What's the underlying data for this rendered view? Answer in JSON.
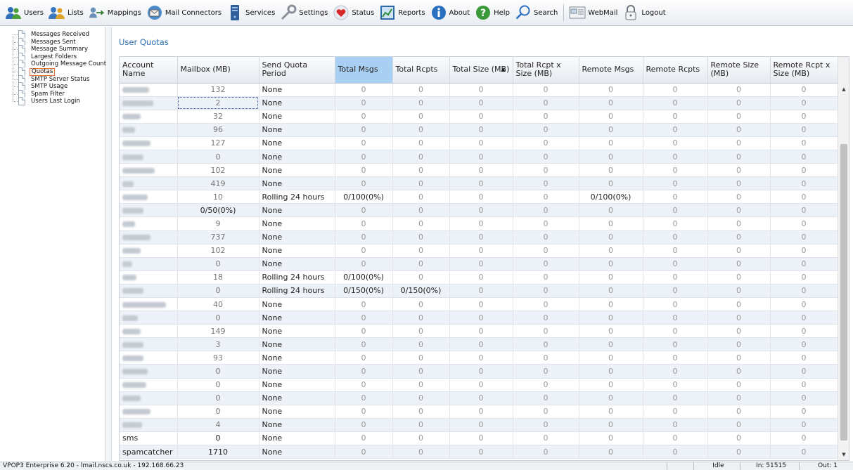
{
  "toolbar": {
    "items": [
      {
        "label": "Users",
        "icon": "users-icon"
      },
      {
        "label": "Lists",
        "icon": "lists-icon"
      },
      {
        "label": "Mappings",
        "icon": "mappings-icon"
      },
      {
        "label": "Mail Connectors",
        "icon": "mail-connectors-icon"
      },
      {
        "label": "Services",
        "icon": "services-icon"
      },
      {
        "label": "Settings",
        "icon": "settings-icon"
      },
      {
        "label": "Status",
        "icon": "status-heart-icon"
      },
      {
        "label": "Reports",
        "icon": "reports-icon"
      },
      {
        "label": "About",
        "icon": "about-info-icon"
      },
      {
        "label": "Help",
        "icon": "help-icon"
      },
      {
        "label": "Search",
        "icon": "search-icon"
      },
      {
        "label": "WebMail",
        "icon": "webmail-icon"
      },
      {
        "label": "Logout",
        "icon": "logout-padlock-icon"
      }
    ]
  },
  "sidebar": {
    "items": [
      {
        "label": "Messages Received",
        "selected": false
      },
      {
        "label": "Messages Sent",
        "selected": false
      },
      {
        "label": "Message Summary",
        "selected": false
      },
      {
        "label": "Largest Folders",
        "selected": false
      },
      {
        "label": "Outgoing Message Counts",
        "selected": false
      },
      {
        "label": "Quotas",
        "selected": true
      },
      {
        "label": "SMTP Server Status",
        "selected": false
      },
      {
        "label": "SMTP Usage",
        "selected": false
      },
      {
        "label": "Spam Filter",
        "selected": false
      },
      {
        "label": "Users Last Login",
        "selected": false
      }
    ]
  },
  "main": {
    "title": "User Quotas",
    "columns": [
      "Account Name",
      "Mailbox (MB)",
      "Send Quota Period",
      "Total Msgs",
      "Total Rcpts",
      "Total Size (MB)",
      "Total Rcpt x Size (MB)",
      "Remote Msgs",
      "Remote Rcpts",
      "Remote Size (MB)",
      "Remote Rcpt x Size (MB)"
    ],
    "sorted_column": "Total Size (MB)",
    "sort_direction": "ascending",
    "highlighted_column": "Total Msgs",
    "rows": [
      {
        "account": "",
        "mailbox": "132",
        "period": "None",
        "total_msgs": "0",
        "total_rcpts": "0",
        "total_size": "0",
        "rcpt_size": "0",
        "remote_msgs": "0",
        "remote_rcpts": "0",
        "remote_size": "0",
        "remote_rcpt_size": "0"
      },
      {
        "account": "",
        "mailbox": "2",
        "period": "None",
        "total_msgs": "0",
        "total_rcpts": "0",
        "total_size": "0",
        "rcpt_size": "0",
        "remote_msgs": "0",
        "remote_rcpts": "0",
        "remote_size": "0",
        "remote_rcpt_size": "0"
      },
      {
        "account": "",
        "mailbox": "32",
        "period": "None",
        "total_msgs": "0",
        "total_rcpts": "0",
        "total_size": "0",
        "rcpt_size": "0",
        "remote_msgs": "0",
        "remote_rcpts": "0",
        "remote_size": "0",
        "remote_rcpt_size": "0"
      },
      {
        "account": "",
        "mailbox": "96",
        "period": "None",
        "total_msgs": "0",
        "total_rcpts": "0",
        "total_size": "0",
        "rcpt_size": "0",
        "remote_msgs": "0",
        "remote_rcpts": "0",
        "remote_size": "0",
        "remote_rcpt_size": "0"
      },
      {
        "account": "",
        "mailbox": "127",
        "period": "None",
        "total_msgs": "0",
        "total_rcpts": "0",
        "total_size": "0",
        "rcpt_size": "0",
        "remote_msgs": "0",
        "remote_rcpts": "0",
        "remote_size": "0",
        "remote_rcpt_size": "0"
      },
      {
        "account": "",
        "mailbox": "0",
        "period": "None",
        "total_msgs": "0",
        "total_rcpts": "0",
        "total_size": "0",
        "rcpt_size": "0",
        "remote_msgs": "0",
        "remote_rcpts": "0",
        "remote_size": "0",
        "remote_rcpt_size": "0"
      },
      {
        "account": "",
        "mailbox": "102",
        "period": "None",
        "total_msgs": "0",
        "total_rcpts": "0",
        "total_size": "0",
        "rcpt_size": "0",
        "remote_msgs": "0",
        "remote_rcpts": "0",
        "remote_size": "0",
        "remote_rcpt_size": "0"
      },
      {
        "account": "",
        "mailbox": "419",
        "period": "None",
        "total_msgs": "0",
        "total_rcpts": "0",
        "total_size": "0",
        "rcpt_size": "0",
        "remote_msgs": "0",
        "remote_rcpts": "0",
        "remote_size": "0",
        "remote_rcpt_size": "0"
      },
      {
        "account": "",
        "mailbox": "10",
        "period": "Rolling 24 hours",
        "total_msgs": "0/100(0%)",
        "total_rcpts": "0",
        "total_size": "0",
        "rcpt_size": "0",
        "remote_msgs": "0/100(0%)",
        "remote_rcpts": "0",
        "remote_size": "0",
        "remote_rcpt_size": "0"
      },
      {
        "account": "",
        "mailbox": "0/50(0%)",
        "period": "None",
        "total_msgs": "0",
        "total_rcpts": "0",
        "total_size": "0",
        "rcpt_size": "0",
        "remote_msgs": "0",
        "remote_rcpts": "0",
        "remote_size": "0",
        "remote_rcpt_size": "0"
      },
      {
        "account": "",
        "mailbox": "9",
        "period": "None",
        "total_msgs": "0",
        "total_rcpts": "0",
        "total_size": "0",
        "rcpt_size": "0",
        "remote_msgs": "0",
        "remote_rcpts": "0",
        "remote_size": "0",
        "remote_rcpt_size": "0"
      },
      {
        "account": "",
        "mailbox": "737",
        "period": "None",
        "total_msgs": "0",
        "total_rcpts": "0",
        "total_size": "0",
        "rcpt_size": "0",
        "remote_msgs": "0",
        "remote_rcpts": "0",
        "remote_size": "0",
        "remote_rcpt_size": "0"
      },
      {
        "account": "",
        "mailbox": "102",
        "period": "None",
        "total_msgs": "0",
        "total_rcpts": "0",
        "total_size": "0",
        "rcpt_size": "0",
        "remote_msgs": "0",
        "remote_rcpts": "0",
        "remote_size": "0",
        "remote_rcpt_size": "0"
      },
      {
        "account": "",
        "mailbox": "0",
        "period": "None",
        "total_msgs": "0",
        "total_rcpts": "0",
        "total_size": "0",
        "rcpt_size": "0",
        "remote_msgs": "0",
        "remote_rcpts": "0",
        "remote_size": "0",
        "remote_rcpt_size": "0"
      },
      {
        "account": "",
        "mailbox": "18",
        "period": "Rolling 24 hours",
        "total_msgs": "0/100(0%)",
        "total_rcpts": "0",
        "total_size": "0",
        "rcpt_size": "0",
        "remote_msgs": "0",
        "remote_rcpts": "0",
        "remote_size": "0",
        "remote_rcpt_size": "0"
      },
      {
        "account": "",
        "mailbox": "0",
        "period": "Rolling 24 hours",
        "total_msgs": "0/150(0%)",
        "total_rcpts": "0/150(0%)",
        "total_size": "0",
        "rcpt_size": "0",
        "remote_msgs": "0",
        "remote_rcpts": "0",
        "remote_size": "0",
        "remote_rcpt_size": "0"
      },
      {
        "account": "",
        "mailbox": "40",
        "period": "None",
        "total_msgs": "0",
        "total_rcpts": "0",
        "total_size": "0",
        "rcpt_size": "0",
        "remote_msgs": "0",
        "remote_rcpts": "0",
        "remote_size": "0",
        "remote_rcpt_size": "0"
      },
      {
        "account": "",
        "mailbox": "0",
        "period": "None",
        "total_msgs": "0",
        "total_rcpts": "0",
        "total_size": "0",
        "rcpt_size": "0",
        "remote_msgs": "0",
        "remote_rcpts": "0",
        "remote_size": "0",
        "remote_rcpt_size": "0"
      },
      {
        "account": "",
        "mailbox": "149",
        "period": "None",
        "total_msgs": "0",
        "total_rcpts": "0",
        "total_size": "0",
        "rcpt_size": "0",
        "remote_msgs": "0",
        "remote_rcpts": "0",
        "remote_size": "0",
        "remote_rcpt_size": "0"
      },
      {
        "account": "",
        "mailbox": "3",
        "period": "None",
        "total_msgs": "0",
        "total_rcpts": "0",
        "total_size": "0",
        "rcpt_size": "0",
        "remote_msgs": "0",
        "remote_rcpts": "0",
        "remote_size": "0",
        "remote_rcpt_size": "0"
      },
      {
        "account": "",
        "mailbox": "93",
        "period": "None",
        "total_msgs": "0",
        "total_rcpts": "0",
        "total_size": "0",
        "rcpt_size": "0",
        "remote_msgs": "0",
        "remote_rcpts": "0",
        "remote_size": "0",
        "remote_rcpt_size": "0"
      },
      {
        "account": "",
        "mailbox": "0",
        "period": "None",
        "total_msgs": "0",
        "total_rcpts": "0",
        "total_size": "0",
        "rcpt_size": "0",
        "remote_msgs": "0",
        "remote_rcpts": "0",
        "remote_size": "0",
        "remote_rcpt_size": "0"
      },
      {
        "account": "",
        "mailbox": "0",
        "period": "None",
        "total_msgs": "0",
        "total_rcpts": "0",
        "total_size": "0",
        "rcpt_size": "0",
        "remote_msgs": "0",
        "remote_rcpts": "0",
        "remote_size": "0",
        "remote_rcpt_size": "0"
      },
      {
        "account": "",
        "mailbox": "0",
        "period": "None",
        "total_msgs": "0",
        "total_rcpts": "0",
        "total_size": "0",
        "rcpt_size": "0",
        "remote_msgs": "0",
        "remote_rcpts": "0",
        "remote_size": "0",
        "remote_rcpt_size": "0"
      },
      {
        "account": "",
        "mailbox": "0",
        "period": "None",
        "total_msgs": "0",
        "total_rcpts": "0",
        "total_size": "0",
        "rcpt_size": "0",
        "remote_msgs": "0",
        "remote_rcpts": "0",
        "remote_size": "0",
        "remote_rcpt_size": "0"
      },
      {
        "account": "",
        "mailbox": "4",
        "period": "None",
        "total_msgs": "0",
        "total_rcpts": "0",
        "total_size": "0",
        "rcpt_size": "0",
        "remote_msgs": "0",
        "remote_rcpts": "0",
        "remote_size": "0",
        "remote_rcpt_size": "0"
      },
      {
        "account": "sms",
        "mailbox": "0",
        "period": "None",
        "total_msgs": "0",
        "total_rcpts": "0",
        "total_size": "0",
        "rcpt_size": "0",
        "remote_msgs": "0",
        "remote_rcpts": "0",
        "remote_size": "0",
        "remote_rcpt_size": "0"
      },
      {
        "account": "spamcatcher",
        "mailbox": "1710",
        "period": "None",
        "total_msgs": "0",
        "total_rcpts": "0",
        "total_size": "0",
        "rcpt_size": "0",
        "remote_msgs": "0",
        "remote_rcpts": "0",
        "remote_size": "0",
        "remote_rcpt_size": "0"
      }
    ]
  },
  "statusbar": {
    "left": "VPOP3 Enterprise 6.20 - lmail.nscs.co.uk - 192.168.66.23",
    "state": "Idle",
    "in": "In: 51515",
    "out": "Out: 1"
  },
  "colors": {
    "accent_title": "#2b6fb3",
    "header_highlight": "#a9d0f2",
    "row_alt": "#edf2f8",
    "selected_border": "#e07a3a"
  }
}
